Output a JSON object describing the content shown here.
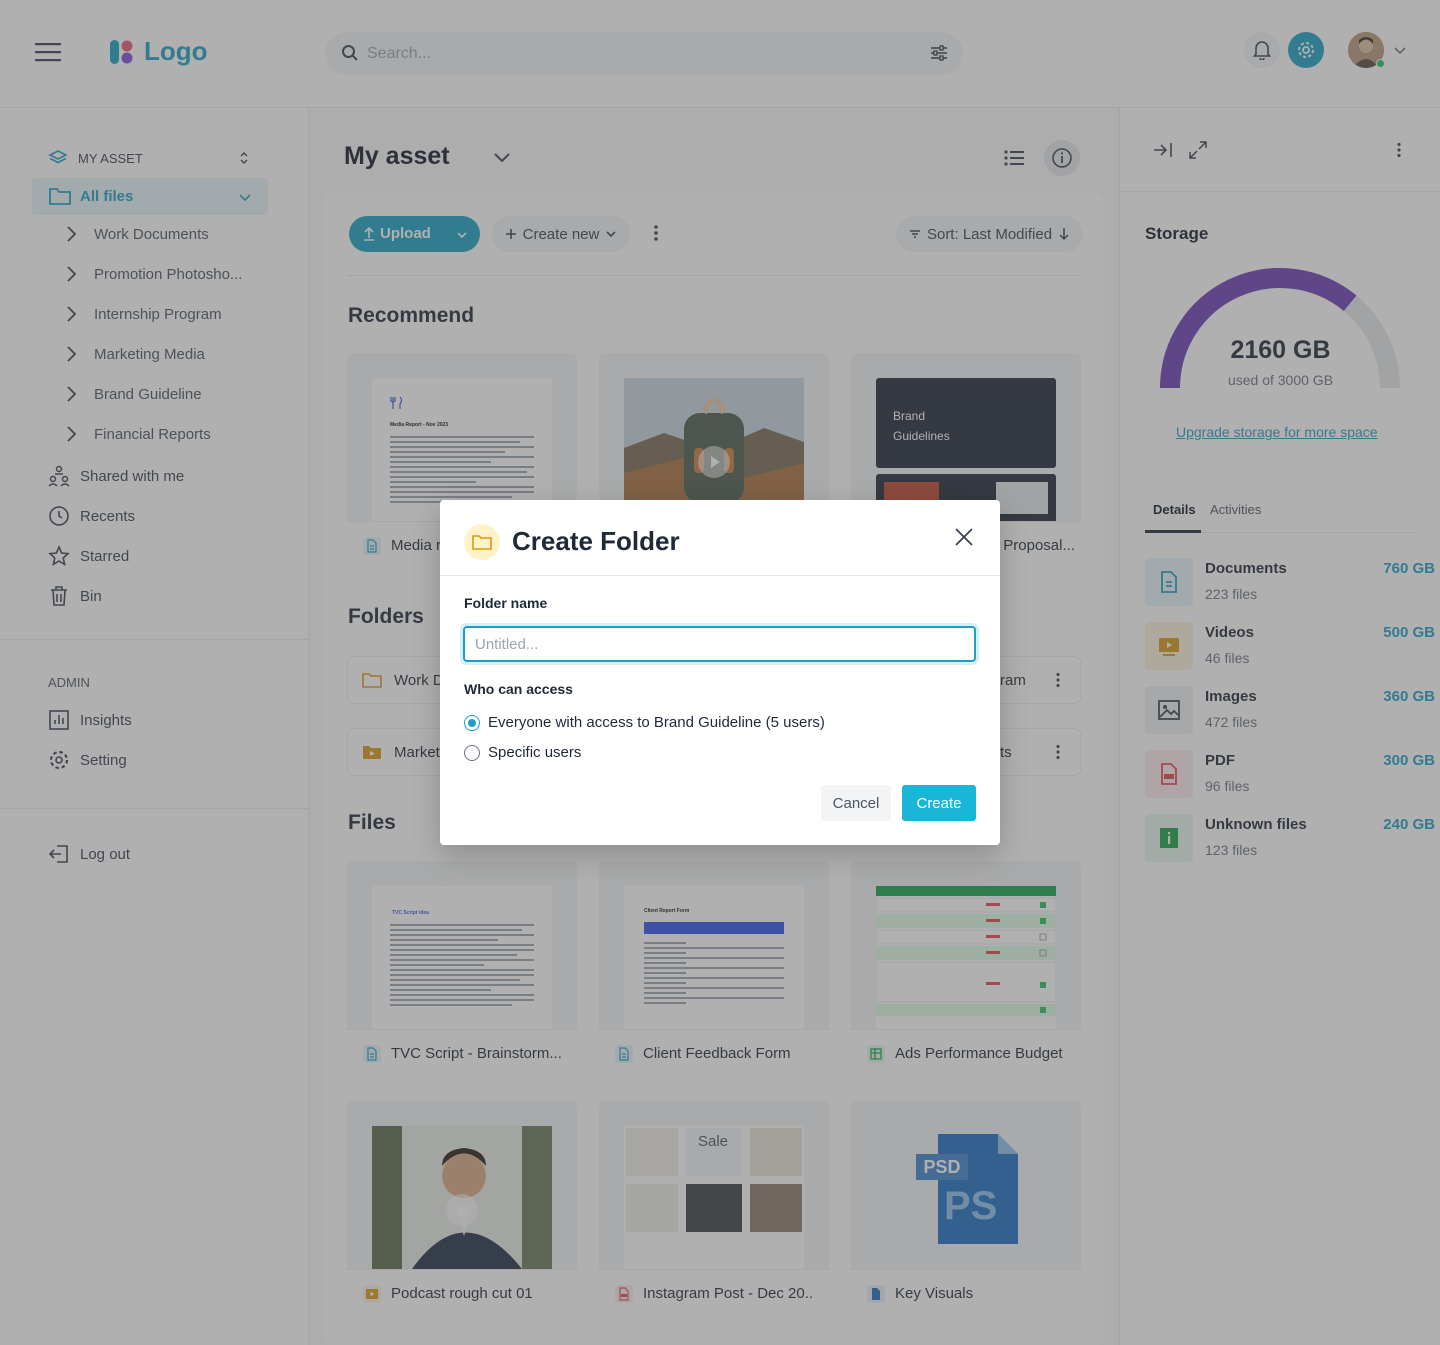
{
  "header": {
    "logo_text": "Logo",
    "search_placeholder": "Search...",
    "icons": [
      "menu-icon",
      "search-icon",
      "filter-icon",
      "bell-icon",
      "gear-icon",
      "chevron-down-icon"
    ],
    "accent_color": "#1aa0c4"
  },
  "sidebar": {
    "workspace_label": "MY ASSET",
    "all_files_label": "All files",
    "folders": [
      "Work Documents",
      "Promotion Photosho...",
      "Internship Program",
      "Marketing Media",
      "Brand Guideline",
      "Financial Reports"
    ],
    "nav": [
      "Shared with me",
      "Recents",
      "Starred",
      "Bin"
    ],
    "admin_label": "ADMIN",
    "admin_items": [
      "Insights",
      "Setting"
    ],
    "logout_label": "Log out"
  },
  "main": {
    "title": "My asset",
    "upload_label": "Upload",
    "create_new_label": "Create new",
    "sort_label": "Sort: Last Modified",
    "recommend_title": "Recommend",
    "recommend": [
      {
        "name": "Media r",
        "doc_title": "Media Report - Nov 2023"
      },
      {
        "name": ""
      },
      {
        "name": "Proposal...",
        "thumb_title": "Brand Guidelines"
      }
    ],
    "folders_title": "Folders",
    "folders": [
      {
        "name": "Work D"
      },
      {
        "name": "ram"
      },
      {
        "name": "Market"
      },
      {
        "name": "ts"
      }
    ],
    "files_title": "Files",
    "files": [
      {
        "name": "TVC Script - Brainstorm...",
        "doc_title": "TVC Script idea"
      },
      {
        "name": "Client Feedback Form",
        "doc_title": "Client Report Form"
      },
      {
        "name": "Ads Performance Budget"
      },
      {
        "name": "Podcast rough cut 01"
      },
      {
        "name": "Instagram Post - Dec 20..",
        "sale_label": "Sale"
      },
      {
        "name": "Key Visuals",
        "psd_badge": "PSD",
        "psd_text": "PS"
      }
    ]
  },
  "storage": {
    "title": "Storage",
    "used": "2160 GB",
    "used_of": "used of 3000 GB",
    "used_fraction": 0.72,
    "upgrade_link": "Upgrade storage for more space",
    "tabs": [
      "Details",
      "Activities"
    ],
    "items": [
      {
        "name": "Documents",
        "count": "223 files",
        "size": "760 GB",
        "color": "#1aa0c4",
        "bg": "#e6f5f9"
      },
      {
        "name": "Videos",
        "count": "46 files",
        "size": "500 GB",
        "color": "#d99a15",
        "bg": "#fdf3dd"
      },
      {
        "name": "Images",
        "count": "472 files",
        "size": "360 GB",
        "color": "#374151",
        "bg": "#eef0f2"
      },
      {
        "name": "PDF",
        "count": "96 files",
        "size": "300 GB",
        "color": "#e5484d",
        "bg": "#fdeced"
      },
      {
        "name": "Unknown files",
        "count": "123 files",
        "size": "240 GB",
        "color": "#16a34a",
        "bg": "#e6f6ec"
      }
    ],
    "gauge_color": "#6b3fb6"
  },
  "modal": {
    "title": "Create Folder",
    "folder_name_label": "Folder name",
    "folder_name_placeholder": "Untitled...",
    "folder_name_value": "",
    "access_label": "Who can access",
    "options": [
      "Everyone with access to Brand Guideline (5 users)",
      "Specific users"
    ],
    "selected_option": 0,
    "cancel_label": "Cancel",
    "create_label": "Create"
  }
}
